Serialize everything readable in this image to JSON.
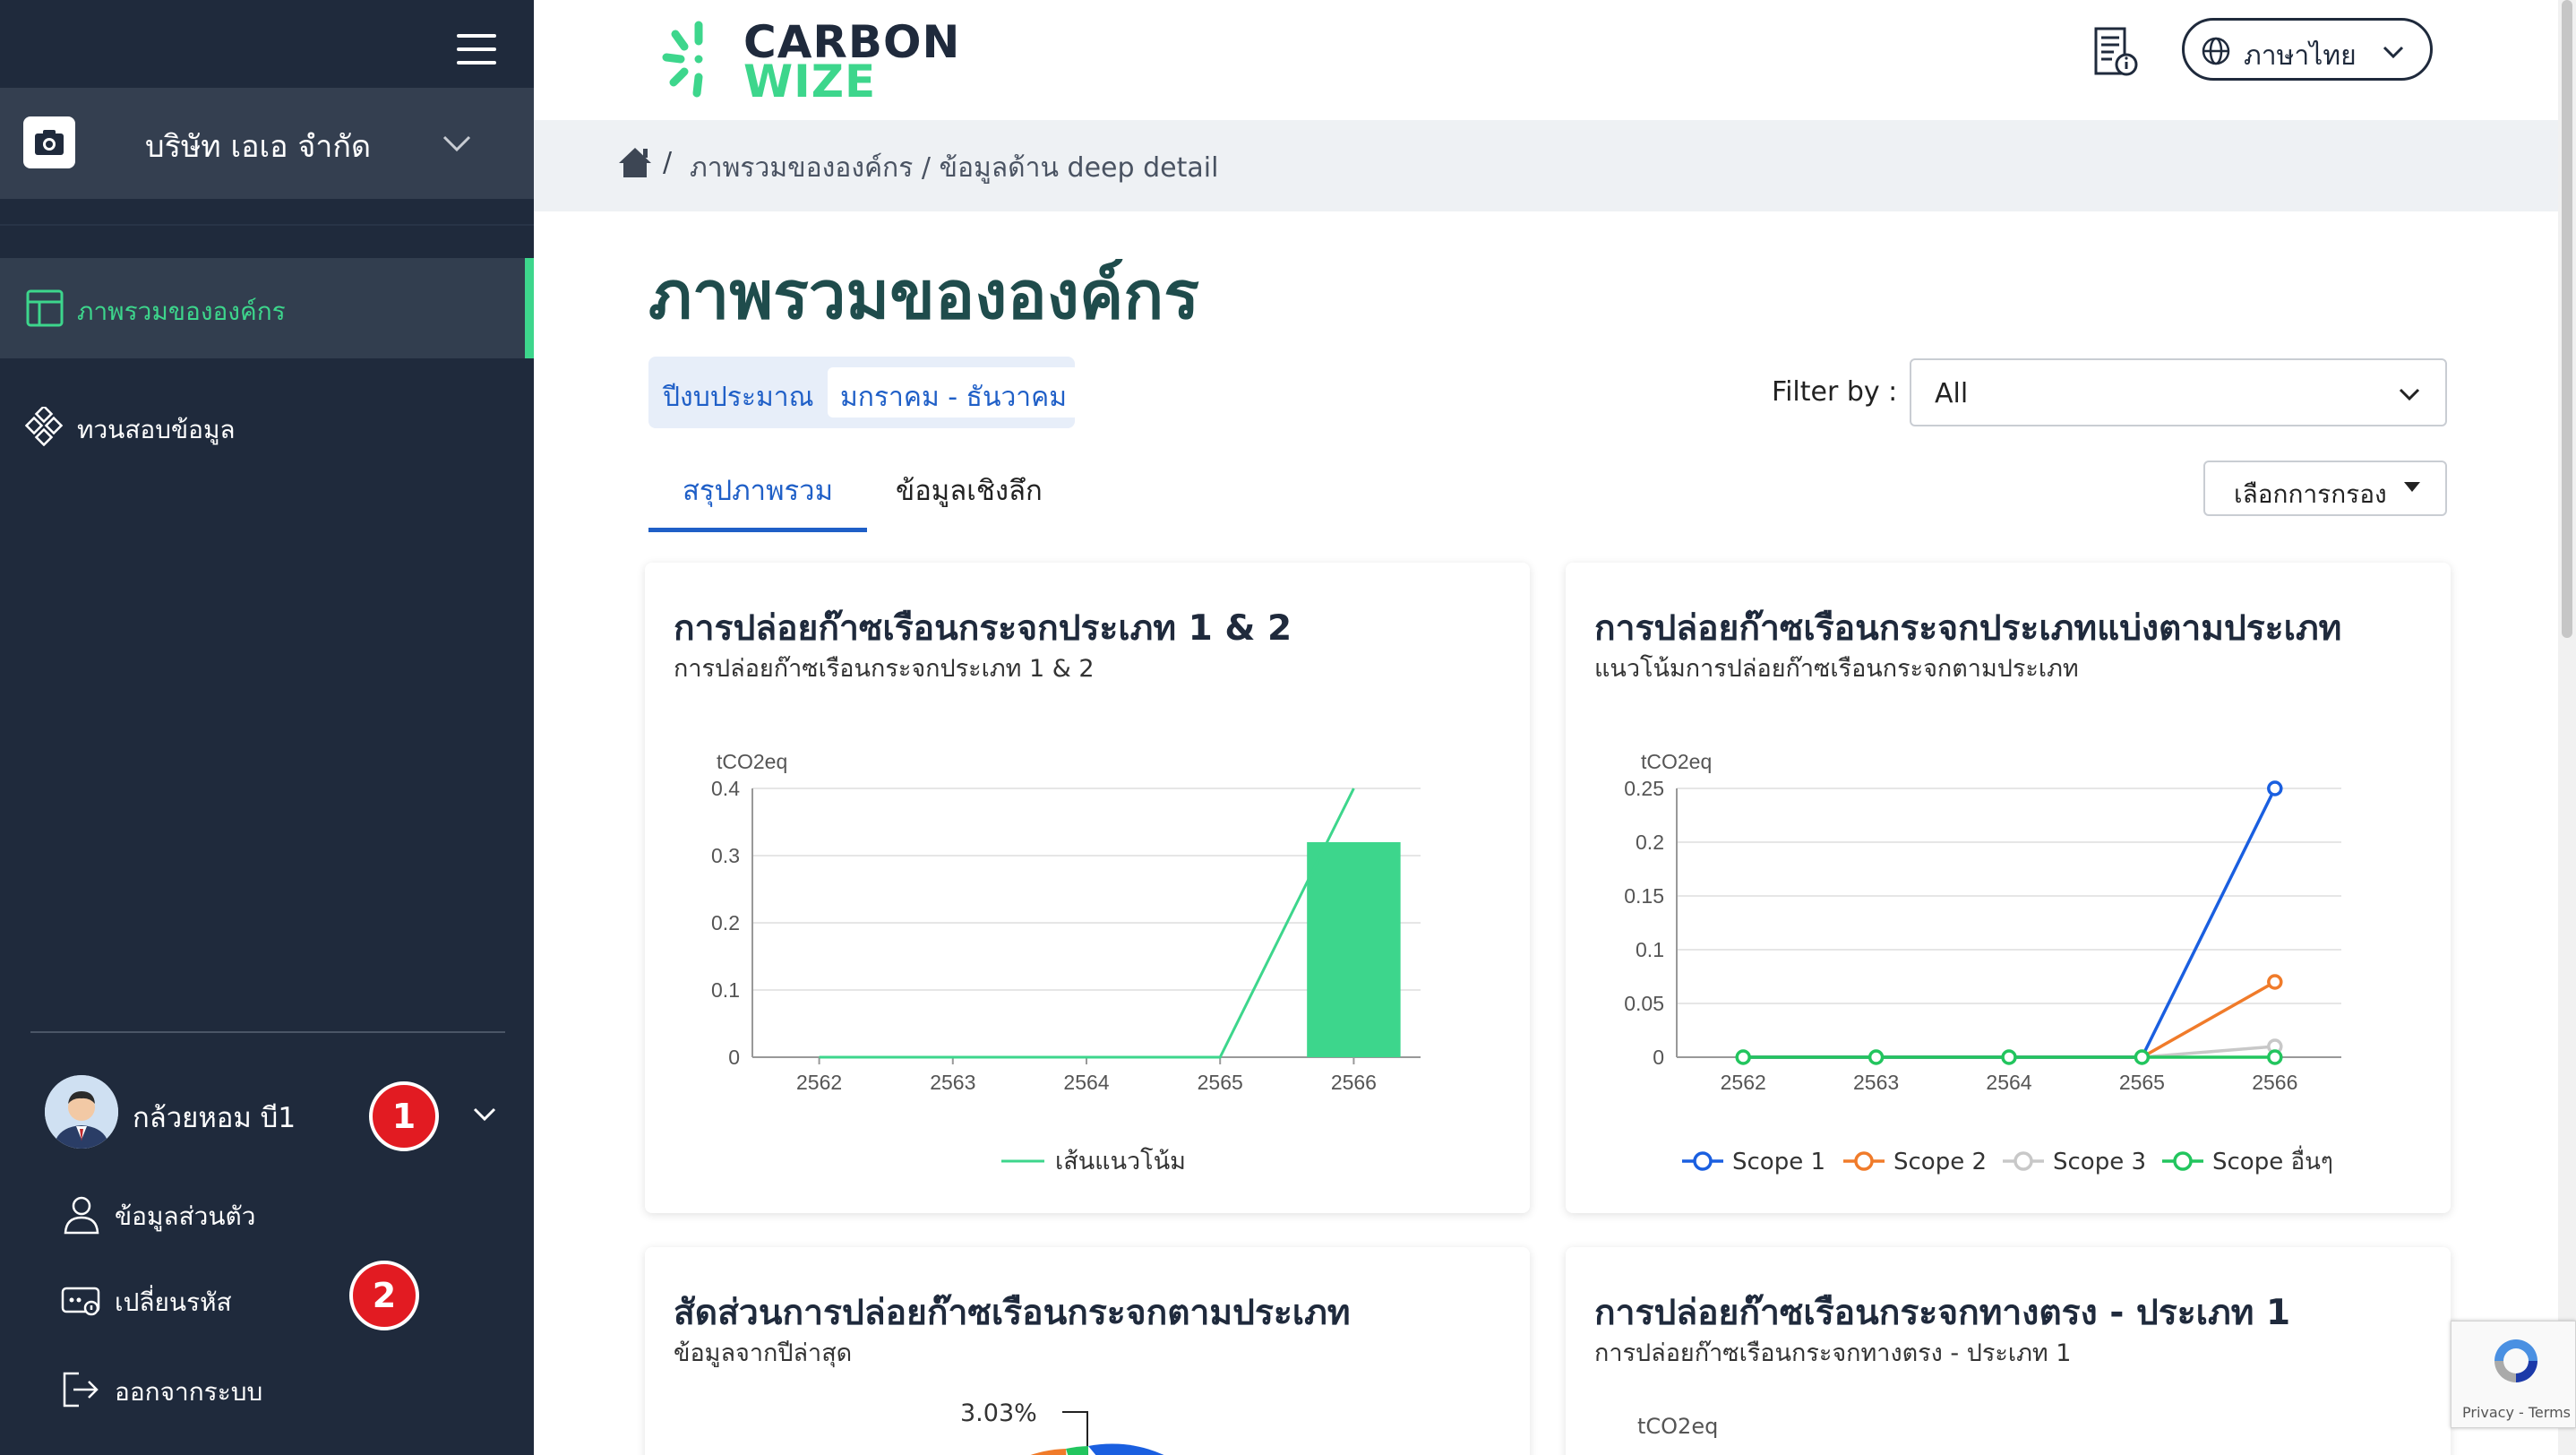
{
  "sidebar": {
    "company_name": "บริษัท เอเอ จำกัด",
    "nav": [
      {
        "label": "ภาพรวมขององค์กร",
        "active": true
      },
      {
        "label": "ทวนสอบข้อมูล",
        "active": false
      }
    ],
    "user": {
      "name": "กล้วยหอม บี1",
      "menu": [
        {
          "label": "ข้อมูลส่วนตัว"
        },
        {
          "label": "เปลี่ยนรหัส"
        },
        {
          "label": "ออกจากระบบ"
        }
      ]
    },
    "badges": [
      "1",
      "2"
    ]
  },
  "header": {
    "logo_line1": "CARBON",
    "logo_line2": "WIZE",
    "language": "ภาษาไทย"
  },
  "breadcrumb": {
    "separator": "/",
    "path": "ภาพรวมขององค์กร / ข้อมูลด้าน deep detail"
  },
  "page": {
    "title": "ภาพรวมขององค์กร",
    "budget_label": "ปีงบประมาณ",
    "budget_value": "มกราคม - ธันวาคม",
    "filter_label": "Filter by :",
    "filter_value": "All",
    "tabs": [
      {
        "label": "สรุปภาพรวม",
        "active": true
      },
      {
        "label": "ข้อมูลเชิงลึก",
        "active": false
      }
    ],
    "filter_dropdown_label": "เลือกการกรอง"
  },
  "cards": [
    {
      "title": "การปล่อยก๊าซเรือนกระจกประเภท 1 & 2",
      "subtitle": "การปล่อยก๊าซเรือนกระจกประเภท 1 & 2"
    },
    {
      "title": "การปล่อยก๊าซเรือนกระจกประเภทแบ่งตามประเภท",
      "subtitle": "แนวโน้มการปล่อยก๊าซเรือนกระจกตามประเภท"
    },
    {
      "title": "สัดส่วนการปล่อยก๊าซเรือนกระจกตามประเภท",
      "subtitle": "ข้อมูลจากปีล่าสุด",
      "pie_label": "3.03%"
    },
    {
      "title": "การปล่อยก๊าซเรือนกระจกทางตรง - ประเภท 1",
      "subtitle": "การปล่อยก๊าซเรือนกระจกทางตรง - ประเภท 1",
      "unit": "tCO2eq"
    }
  ],
  "recaptcha": {
    "text": "Privacy - Terms"
  },
  "colors": {
    "sidebar_bg": "#1f2a3c",
    "accent_green": "#3dd68c",
    "accent_blue": "#1f5fc7",
    "scope1": "#1a5fe0",
    "scope2": "#f07b2a",
    "scope3": "#c8c8c8",
    "scope_other": "#22c55e",
    "badge_red": "#e21b22"
  },
  "chart_data": [
    {
      "type": "bar",
      "ylabel": "tCO2eq",
      "categories": [
        "2562",
        "2563",
        "2564",
        "2565",
        "2566"
      ],
      "ylim": [
        0,
        0.4
      ],
      "yticks": [
        0,
        0.1,
        0.2,
        0.3,
        0.4
      ],
      "series": [
        {
          "kind": "bar",
          "values": [
            0,
            0,
            0,
            0,
            0.32
          ]
        },
        {
          "name": "เส้นแนวโน้ม",
          "kind": "line",
          "values": [
            0,
            0,
            0,
            0,
            0.4
          ]
        }
      ],
      "grid": true,
      "legend": "bottom-center"
    },
    {
      "type": "line",
      "ylabel": "tCO2eq",
      "categories": [
        "2562",
        "2563",
        "2564",
        "2565",
        "2566"
      ],
      "ylim": [
        0,
        0.25
      ],
      "yticks": [
        0,
        0.05,
        0.1,
        0.15,
        0.2,
        0.25
      ],
      "series": [
        {
          "name": "Scope 1",
          "values": [
            0,
            0,
            0,
            0,
            0.25
          ]
        },
        {
          "name": "Scope 2",
          "values": [
            0,
            0,
            0,
            0,
            0.07
          ]
        },
        {
          "name": "Scope 3",
          "values": [
            0,
            0,
            0,
            0,
            0.01
          ]
        },
        {
          "name": "Scope อื่นๆ",
          "values": [
            0,
            0,
            0,
            0,
            0
          ]
        }
      ],
      "grid": true,
      "legend": "bottom-center"
    }
  ]
}
